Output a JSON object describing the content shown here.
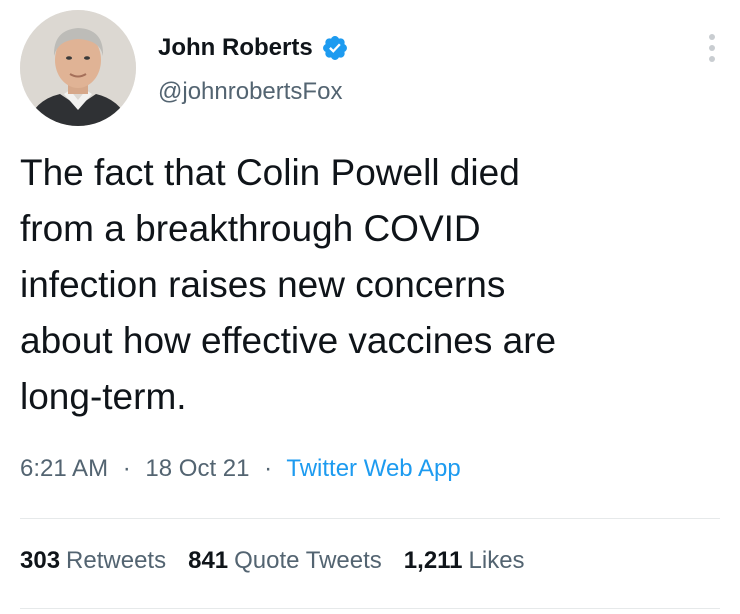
{
  "author": {
    "display_name": "John Roberts",
    "handle": "@johnrobertsFox",
    "verified": true
  },
  "tweet": {
    "text": "The fact that Colin Powell died\nfrom a breakthrough COVID\ninfection raises new concerns\nabout how effective vaccines are\nlong-term.",
    "time": "6:21 AM",
    "separator": "·",
    "date": "18 Oct 21",
    "source": "Twitter Web App"
  },
  "stats": {
    "retweets_count": "303",
    "retweets_label": "Retweets",
    "quote_tweets_count": "841",
    "quote_tweets_label": "Quote Tweets",
    "likes_count": "1,211",
    "likes_label": "Likes"
  },
  "colors": {
    "text_primary": "#0f1419",
    "text_secondary": "#536471",
    "accent": "#1d9bf0",
    "divider": "#e6e9ea"
  },
  "icons": {
    "verified": "verified-badge-icon",
    "more": "more-options-icon"
  }
}
